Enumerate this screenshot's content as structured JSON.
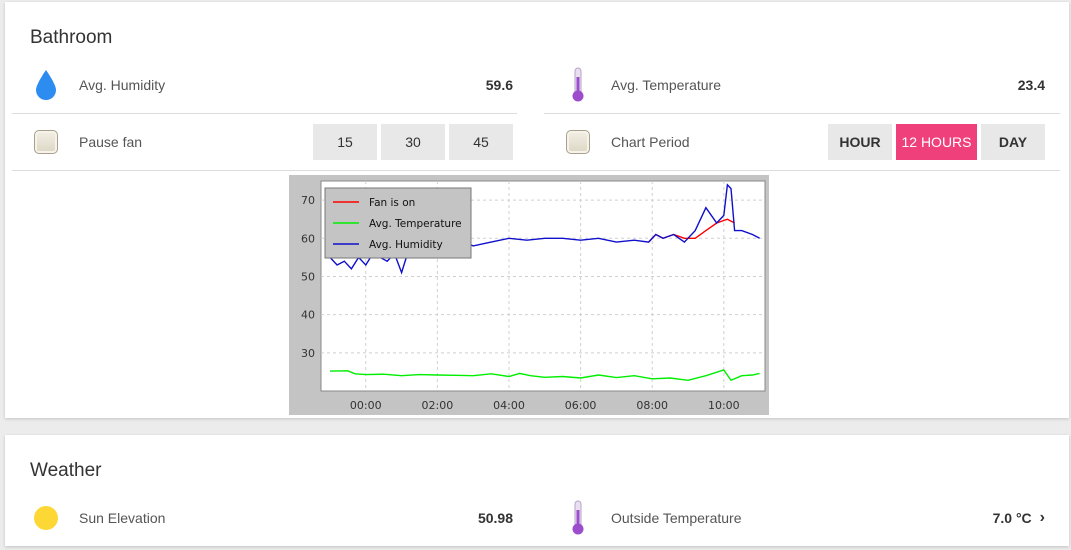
{
  "bathroom": {
    "title": "Bathroom",
    "humidity": {
      "label": "Avg. Humidity",
      "value": "59.6",
      "icon": "water-drop-icon"
    },
    "temperature": {
      "label": "Avg. Temperature",
      "value": "23.4",
      "icon": "thermometer-icon"
    },
    "pause_fan": {
      "label": "Pause fan",
      "options": [
        "15",
        "30",
        "45"
      ]
    },
    "chart_period": {
      "label": "Chart Period",
      "options": [
        "HOUR",
        "12 HOURS",
        "DAY"
      ],
      "selected": "12 HOURS"
    }
  },
  "weather": {
    "title": "Weather",
    "sun": {
      "label": "Sun Elevation",
      "value": "50.98",
      "icon": "sun-icon"
    },
    "outside": {
      "label": "Outside Temperature",
      "value": "7.0 °C",
      "icon": "thermometer-icon"
    }
  },
  "colors": {
    "accent": "#f0407c",
    "drop": "#2d8cf0",
    "sun": "#fdd835",
    "thermo": "#9c4dcc"
  },
  "chart_data": {
    "type": "line",
    "x_ticks": [
      "00:00",
      "02:00",
      "04:00",
      "06:00",
      "08:00",
      "10:00"
    ],
    "y_ticks": [
      30,
      40,
      50,
      60,
      70
    ],
    "ylim": [
      20,
      75
    ],
    "xlim": [
      -1.25,
      11.15
    ],
    "grid": true,
    "legend_position": "top-left",
    "series": [
      {
        "name": "Fan is on",
        "color": "#ff0000",
        "x": [
          7.9,
          8.1,
          8.3,
          8.6,
          8.9,
          9.2,
          9.5,
          9.8,
          10.1,
          10.3
        ],
        "y": [
          59,
          61,
          60,
          61,
          60,
          60,
          62,
          64,
          65,
          64
        ]
      },
      {
        "name": "Avg. Temperature",
        "color": "#00ee00",
        "x": [
          -1.0,
          -0.5,
          -0.3,
          0,
          0.5,
          1,
          1.5,
          2,
          2.5,
          3,
          3.5,
          4,
          4.3,
          4.6,
          5,
          5.5,
          6,
          6.5,
          7,
          7.5,
          8,
          8.5,
          9,
          9.5,
          10,
          10.2,
          10.5,
          10.8,
          11.0
        ],
        "y": [
          25.2,
          25.3,
          24.5,
          24.3,
          24.4,
          24.0,
          24.3,
          24.2,
          24.1,
          24.0,
          24.5,
          23.8,
          24.6,
          24.0,
          23.6,
          23.8,
          23.4,
          24.2,
          23.5,
          24.0,
          23.2,
          23.4,
          22.8,
          24.0,
          25.5,
          22.8,
          24.0,
          24.2,
          24.6
        ]
      },
      {
        "name": "Avg. Humidity",
        "color": "#1010cc",
        "x": [
          -1.0,
          -0.8,
          -0.6,
          -0.4,
          -0.2,
          0,
          0.2,
          0.4,
          0.6,
          0.8,
          1.0,
          1.2,
          1.4,
          1.6,
          1.8,
          2.0,
          2.5,
          3.0,
          3.5,
          4.0,
          4.5,
          5.0,
          5.5,
          6.0,
          6.5,
          7.0,
          7.5,
          7.9,
          8.1,
          8.3,
          8.6,
          8.9,
          9.2,
          9.5,
          9.8,
          10.0,
          10.1,
          10.2,
          10.3,
          10.5,
          10.8,
          11.0
        ],
        "y": [
          55,
          53,
          54,
          52,
          55,
          53,
          56,
          55,
          54,
          56,
          51,
          57,
          56,
          58,
          57,
          59,
          60,
          58,
          59,
          60,
          59.5,
          60,
          60,
          59.5,
          60,
          59,
          59.5,
          59,
          61,
          60,
          61,
          59,
          62,
          68,
          64,
          66,
          74,
          73,
          62,
          62,
          61,
          60
        ]
      }
    ]
  }
}
